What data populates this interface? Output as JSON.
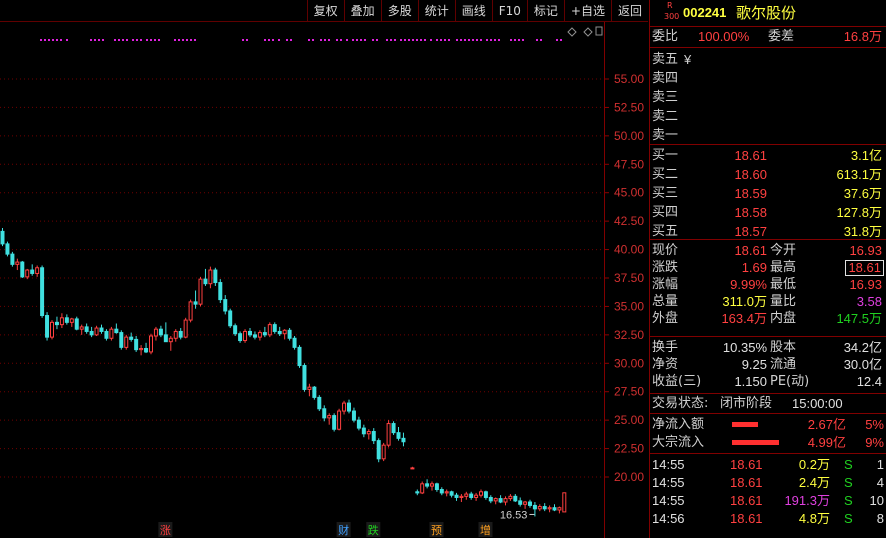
{
  "toolbar": {
    "buttons": [
      "复权",
      "叠加",
      "多股",
      "统计",
      "画线",
      "F10",
      "标记",
      "+自选",
      "返回"
    ]
  },
  "stock": {
    "badge_top": "R",
    "badge_bottom": "300",
    "code": "002241",
    "name": "歌尔股份"
  },
  "commission": {
    "ratio_label": "委比",
    "ratio": "100.00%",
    "diff_label": "委差",
    "diff": "16.8万"
  },
  "sell_levels": [
    {
      "label": "卖五",
      "price": "¥",
      "vol": ""
    },
    {
      "label": "卖四",
      "price": "",
      "vol": ""
    },
    {
      "label": "卖三",
      "price": "",
      "vol": ""
    },
    {
      "label": "卖二",
      "price": "",
      "vol": ""
    },
    {
      "label": "卖一",
      "price": "",
      "vol": ""
    }
  ],
  "buy_levels": [
    {
      "label": "买一",
      "price": "18.61",
      "vol": "3.1亿"
    },
    {
      "label": "买二",
      "price": "18.60",
      "vol": "613.1万"
    },
    {
      "label": "买三",
      "price": "18.59",
      "vol": "37.6万"
    },
    {
      "label": "买四",
      "price": "18.58",
      "vol": "127.8万"
    },
    {
      "label": "买五",
      "price": "18.57",
      "vol": "31.8万"
    }
  ],
  "stats": {
    "now_label": "现价",
    "now": "18.61",
    "open_label": "今开",
    "open": "16.93",
    "chg_label": "涨跌",
    "chg": "1.69",
    "high_label": "最高",
    "high": "18.61",
    "pct_label": "涨幅",
    "pct": "9.99%",
    "low_label": "最低",
    "low": "16.93",
    "vol_label": "总量",
    "vol": "311.0万",
    "vr_label": "量比",
    "vr": "3.58",
    "outer_label": "外盘",
    "outer": "163.4万",
    "inner_label": "内盘",
    "inner": "147.5万",
    "turn_label": "换手",
    "turn": "10.35%",
    "cap_label": "股本",
    "cap": "34.2亿",
    "nav_label": "净资",
    "nav": "9.25",
    "float_label": "流通",
    "float": "30.0亿",
    "eps_label": "收益(三)",
    "eps": "1.150",
    "pe_label": "PE(动)",
    "pe": "12.4"
  },
  "trade_status": {
    "label": "交易状态:",
    "phase": "闭市阶段",
    "time": "15:00:00"
  },
  "flows": [
    {
      "label": "净流入额",
      "value": "2.67亿",
      "pct": "5%",
      "bar_fraction": 0.5
    },
    {
      "label": "大宗流入",
      "value": "4.99亿",
      "pct": "9%",
      "bar_fraction": 0.9
    }
  ],
  "ticks": [
    {
      "time": "14:55",
      "price": "18.61",
      "vol": "0.2万",
      "side": "S",
      "count": "1"
    },
    {
      "time": "14:55",
      "price": "18.61",
      "vol": "2.4万",
      "side": "S",
      "count": "4"
    },
    {
      "time": "14:55",
      "price": "18.61",
      "vol": "191.3万",
      "side": "S",
      "count": "10"
    },
    {
      "time": "14:56",
      "price": "18.61",
      "vol": "4.8万",
      "side": "S",
      "count": "8"
    }
  ],
  "chart_data": {
    "type": "candlestick",
    "y_ticks": [
      "55.00",
      "52.50",
      "50.00",
      "47.50",
      "45.00",
      "42.50",
      "40.00",
      "37.50",
      "35.00",
      "32.50",
      "30.00",
      "27.50",
      "25.00",
      "22.50",
      "20.00"
    ],
    "ylim": [
      16.5,
      57.5
    ],
    "low_annotation": "16.53",
    "event_labels": [
      {
        "text": "涨",
        "color": "#ff4040",
        "bar_index": 32
      },
      {
        "text": "财",
        "color": "#40a0ff",
        "bar_index": 68
      },
      {
        "text": "跌",
        "color": "#20d020",
        "bar_index": 74
      },
      {
        "text": "预",
        "color": "#ffa020",
        "bar_index": 86
      },
      {
        "text": "增",
        "color": "#ffa020",
        "bar_index": 96
      }
    ],
    "marker_color": "#e020e0",
    "up_color": "#ff4040",
    "down_color": "#40e0e0",
    "candles": [
      [
        41.6,
        41.9,
        40.3,
        40.5
      ],
      [
        40.5,
        40.7,
        39.4,
        39.6
      ],
      [
        39.6,
        39.8,
        38.5,
        38.7
      ],
      [
        38.7,
        39.2,
        38.2,
        38.9
      ],
      [
        38.9,
        39.0,
        37.5,
        37.6
      ],
      [
        37.6,
        38.3,
        37.4,
        38.2
      ],
      [
        38.2,
        38.7,
        37.7,
        37.9
      ],
      [
        37.9,
        38.6,
        37.6,
        38.4
      ],
      [
        38.4,
        38.6,
        34.0,
        34.2
      ],
      [
        34.2,
        34.5,
        32.0,
        32.3
      ],
      [
        32.3,
        33.8,
        32.1,
        33.6
      ],
      [
        33.6,
        34.1,
        33.0,
        33.4
      ],
      [
        33.4,
        34.4,
        33.1,
        34.0
      ],
      [
        34.0,
        34.3,
        33.4,
        33.6
      ],
      [
        33.6,
        34.0,
        33.2,
        33.9
      ],
      [
        33.9,
        34.1,
        32.9,
        33.0
      ],
      [
        33.0,
        33.4,
        32.5,
        33.2
      ],
      [
        33.2,
        33.5,
        32.6,
        32.8
      ],
      [
        32.8,
        33.2,
        32.3,
        32.5
      ],
      [
        32.5,
        33.3,
        32.4,
        33.1
      ],
      [
        33.1,
        33.4,
        32.6,
        32.8
      ],
      [
        32.8,
        33.0,
        32.0,
        32.2
      ],
      [
        32.2,
        33.2,
        32.0,
        33.0
      ],
      [
        33.0,
        33.5,
        32.6,
        32.7
      ],
      [
        32.7,
        32.9,
        31.2,
        31.4
      ],
      [
        31.4,
        32.5,
        31.2,
        32.3
      ],
      [
        32.3,
        32.7,
        31.9,
        32.1
      ],
      [
        32.1,
        32.4,
        31.0,
        31.2
      ],
      [
        31.2,
        31.6,
        30.7,
        31.3
      ],
      [
        31.3,
        31.8,
        30.9,
        31.0
      ],
      [
        31.0,
        32.6,
        30.8,
        32.4
      ],
      [
        32.4,
        33.2,
        32.0,
        33.0
      ],
      [
        33.0,
        33.3,
        32.3,
        32.5
      ],
      [
        32.5,
        33.6,
        31.9,
        31.9
      ],
      [
        31.9,
        32.4,
        31.1,
        32.2
      ],
      [
        32.2,
        33.0,
        31.9,
        32.8
      ],
      [
        32.8,
        33.1,
        32.1,
        32.3
      ],
      [
        32.3,
        34.0,
        32.2,
        33.8
      ],
      [
        33.8,
        35.6,
        33.6,
        35.4
      ],
      [
        35.4,
        36.4,
        34.8,
        35.2
      ],
      [
        35.2,
        37.6,
        35.0,
        37.4
      ],
      [
        37.4,
        38.3,
        36.8,
        37.0
      ],
      [
        37.0,
        38.5,
        36.6,
        38.2
      ],
      [
        38.2,
        38.4,
        36.8,
        37.1
      ],
      [
        37.1,
        37.4,
        35.3,
        35.6
      ],
      [
        35.6,
        36.0,
        34.3,
        34.6
      ],
      [
        34.6,
        34.8,
        33.1,
        33.3
      ],
      [
        33.3,
        33.5,
        32.4,
        32.6
      ],
      [
        32.6,
        32.8,
        31.8,
        32.0
      ],
      [
        32.0,
        33.0,
        31.8,
        32.8
      ],
      [
        32.8,
        33.1,
        32.3,
        32.5
      ],
      [
        32.5,
        32.8,
        32.1,
        32.3
      ],
      [
        32.3,
        32.9,
        32.0,
        32.7
      ],
      [
        32.7,
        33.2,
        32.3,
        32.5
      ],
      [
        32.5,
        33.6,
        32.3,
        33.4
      ],
      [
        33.4,
        33.6,
        32.6,
        32.8
      ],
      [
        32.8,
        33.2,
        32.4,
        32.6
      ],
      [
        32.6,
        33.0,
        32.1,
        32.9
      ],
      [
        32.9,
        33.1,
        32.0,
        32.2
      ],
      [
        32.2,
        32.4,
        31.2,
        31.4
      ],
      [
        31.4,
        31.6,
        29.6,
        29.8
      ],
      [
        29.8,
        30.0,
        27.5,
        27.7
      ],
      [
        27.7,
        28.2,
        27.1,
        27.9
      ],
      [
        27.9,
        28.0,
        26.8,
        27.0
      ],
      [
        27.0,
        27.2,
        25.8,
        26.0
      ],
      [
        26.0,
        26.3,
        24.9,
        25.2
      ],
      [
        25.2,
        25.6,
        24.6,
        25.4
      ],
      [
        25.4,
        25.6,
        24.0,
        24.2
      ],
      [
        24.2,
        26.0,
        24.1,
        25.8
      ],
      [
        25.8,
        26.7,
        25.5,
        26.5
      ],
      [
        26.5,
        26.8,
        25.6,
        25.8
      ],
      [
        25.8,
        26.1,
        24.8,
        25.0
      ],
      [
        25.0,
        25.3,
        24.1,
        24.3
      ],
      [
        24.3,
        24.6,
        23.5,
        23.8
      ],
      [
        23.8,
        24.2,
        23.3,
        24.0
      ],
      [
        24.0,
        24.3,
        22.9,
        23.2
      ],
      [
        23.2,
        23.4,
        21.3,
        21.6
      ],
      [
        21.6,
        23.0,
        21.4,
        22.8
      ],
      [
        22.8,
        25.0,
        22.6,
        24.7
      ],
      [
        24.7,
        24.9,
        23.7,
        23.9
      ],
      [
        23.9,
        24.4,
        23.2,
        23.4
      ],
      [
        23.4,
        23.9,
        22.7,
        23.1
      ]
    ],
    "tail_candles": [
      [
        20.8,
        20.9,
        20.7,
        20.8
      ],
      [
        18.7,
        18.9,
        18.4,
        18.6
      ],
      [
        18.6,
        19.6,
        18.5,
        19.4
      ],
      [
        19.4,
        19.8,
        19.0,
        19.2
      ],
      [
        19.2,
        19.6,
        18.8,
        19.4
      ],
      [
        19.4,
        19.5,
        18.7,
        18.9
      ],
      [
        18.9,
        19.1,
        18.4,
        18.6
      ],
      [
        18.6,
        18.9,
        18.3,
        18.7
      ],
      [
        18.7,
        18.8,
        18.2,
        18.4
      ],
      [
        18.4,
        18.6,
        17.9,
        18.2
      ],
      [
        18.2,
        18.5,
        17.8,
        18.3
      ],
      [
        18.3,
        18.7,
        18.0,
        18.5
      ],
      [
        18.5,
        18.7,
        18.0,
        18.2
      ],
      [
        18.2,
        18.6,
        17.9,
        18.4
      ],
      [
        18.4,
        18.9,
        18.2,
        18.7
      ],
      [
        18.7,
        18.8,
        18.0,
        18.2
      ],
      [
        18.2,
        18.4,
        17.7,
        17.9
      ],
      [
        17.9,
        18.2,
        17.6,
        18.1
      ],
      [
        18.1,
        18.4,
        17.7,
        17.8
      ],
      [
        17.8,
        18.3,
        17.5,
        18.1
      ],
      [
        18.1,
        18.5,
        17.9,
        18.3
      ],
      [
        18.3,
        18.5,
        17.8,
        17.9
      ],
      [
        17.9,
        18.2,
        17.4,
        17.6
      ],
      [
        17.6,
        17.9,
        17.2,
        17.8
      ],
      [
        17.8,
        18.0,
        17.3,
        17.5
      ],
      [
        17.5,
        17.8,
        16.53,
        17.2
      ],
      [
        17.2,
        17.6,
        17.0,
        17.4
      ],
      [
        17.4,
        17.7,
        17.0,
        17.2
      ],
      [
        17.2,
        17.5,
        16.9,
        17.3
      ],
      [
        17.3,
        17.6,
        17.0,
        17.1
      ],
      [
        17.1,
        17.4,
        16.8,
        17.3
      ],
      [
        16.93,
        18.61,
        16.93,
        18.61
      ]
    ]
  }
}
